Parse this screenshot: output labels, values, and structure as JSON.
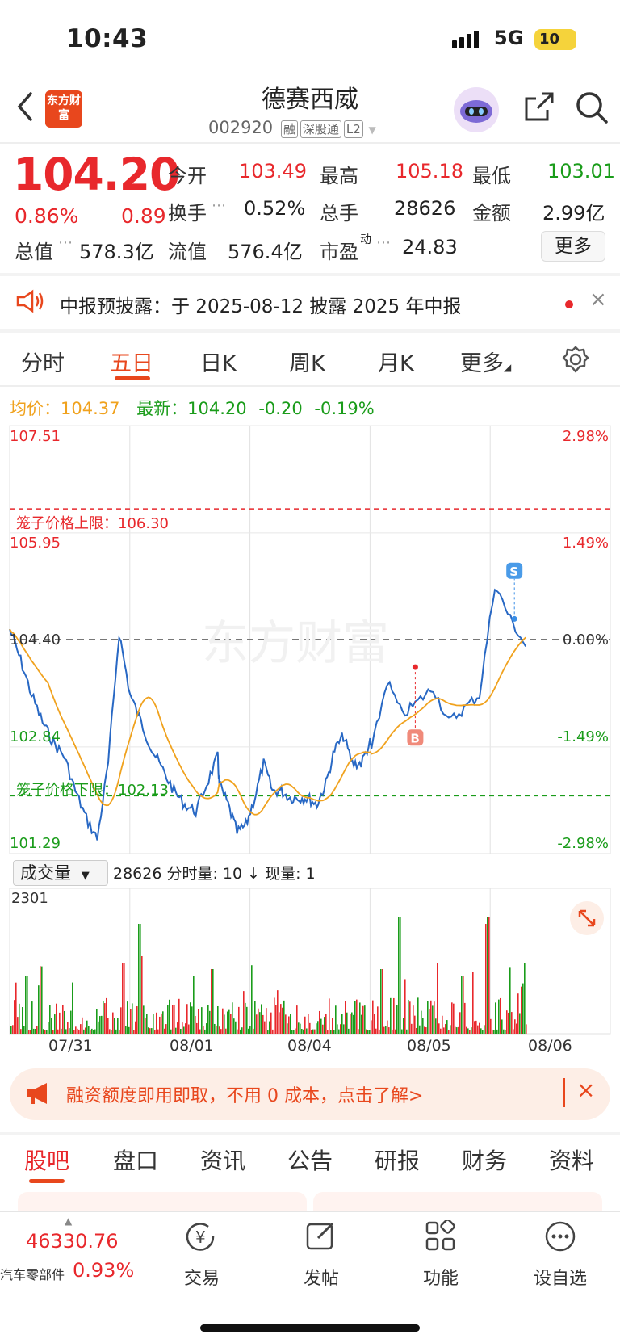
{
  "status": {
    "time": "10:43",
    "network": "5G",
    "battery": "10"
  },
  "header": {
    "logo": "东方财富",
    "name": "德赛西威",
    "code": "002920",
    "tags": [
      "融",
      "深股通",
      "L2"
    ]
  },
  "quote": {
    "price": "104.20",
    "pct": "0.86%",
    "chg": "0.89",
    "open_l": "今开",
    "open": "103.49",
    "high_l": "最高",
    "high": "105.18",
    "low_l": "最低",
    "low": "103.01",
    "turn_l": "换手",
    "turn": "0.52%",
    "vol_l": "总手",
    "vol": "28626",
    "amt_l": "金额",
    "amt": "2.99亿",
    "mcap_l": "总值",
    "mcap": "578.3亿",
    "fcap_l": "流值",
    "fcap": "576.4亿",
    "pe_l": "市盈",
    "pe_sup": "动",
    "pe": "24.83",
    "more": "更多"
  },
  "notice": {
    "text": "中报预披露：于 2025-08-12 披露 2025 年中报"
  },
  "tabs": [
    "分时",
    "五日",
    "日K",
    "周K",
    "月K",
    "更多"
  ],
  "legend": {
    "avg_l": "均价：",
    "avg": "104.37",
    "last_l": "最新：",
    "last": "104.20",
    "chg": "-0.20",
    "pct": "-0.19%"
  },
  "chart_data": {
    "type": "line",
    "title": "",
    "x_labels": [
      "07/31",
      "08/01",
      "08/04",
      "08/05",
      "08/06"
    ],
    "y_left": [
      "107.51",
      "105.95",
      "104.40",
      "102.84",
      "101.29"
    ],
    "y_right": [
      "2.98%",
      "1.49%",
      "0.00%",
      "-1.49%",
      "-2.98%"
    ],
    "ylim": [
      101.29,
      107.51
    ],
    "upper_limit_label": "笼子价格上限：106.30",
    "upper_limit": 106.3,
    "lower_limit_label": "笼子价格下限：102.13",
    "lower_limit": 102.13,
    "prev_close": 104.4,
    "markers": [
      {
        "label": "B",
        "price": 103.0
      },
      {
        "label": "S",
        "price": 105.4
      }
    ],
    "series": [
      {
        "values": [
          104.55,
          104.1,
          103.6,
          103.2,
          102.9,
          102.7,
          102.2,
          101.8,
          101.5,
          102.6,
          104.5,
          103.6,
          103.2,
          102.8,
          102.5,
          102.2,
          102.0,
          101.9,
          102.3,
          102.7
        ],
        "values_day2": [
          102.3,
          102.0,
          101.6,
          101.7,
          102.1,
          102.6,
          102.2,
          102.2,
          102.1,
          102.1,
          102.1,
          102.0,
          102.3,
          102.8,
          103.0,
          102.6,
          102.6,
          102.9
        ],
        "values_day4": [
          102.8,
          103.8,
          103.3,
          103.5,
          103.7,
          103.2,
          103.4,
          103.6,
          105.2,
          104.7,
          104.3
        ]
      },
      {
        "name_avg": ""
      }
    ]
  },
  "volume": {
    "selector": "成交量",
    "info": "28626 分时量: 10 ↓ 现量: 1",
    "max": "2301"
  },
  "banner": {
    "text": "融资额度即用即取，不用 0 成本，点击了解>"
  },
  "bottom_tabs": [
    "股吧",
    "盘口",
    "资讯",
    "公告",
    "研报",
    "财务",
    "资料"
  ],
  "nav": {
    "index_value": "46330.76",
    "index_name": "汽车零部件",
    "index_pct": "0.93%",
    "items": [
      "交易",
      "发帖",
      "功能",
      "设自选"
    ]
  }
}
